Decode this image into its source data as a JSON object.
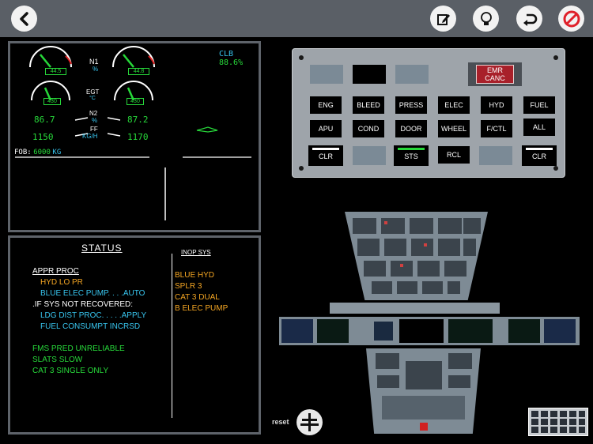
{
  "colors": {
    "topbar": "#5a5f66",
    "green": "#27d83a",
    "cyan": "#38c6f0",
    "amber": "#f5a623",
    "white": "#ffffff"
  },
  "toolbar": {
    "back_icon": "chevron-left-icon",
    "edit_icon": "edit-icon",
    "hint_icon": "lightbulb-icon",
    "undo_icon": "undo-icon",
    "cancel_icon": "no-entry-icon"
  },
  "ewd": {
    "n1_label": "N1",
    "n1_unit": "%",
    "n1_left": "44.5",
    "n1_right": "44.8",
    "mode": "CLB",
    "thrust_limit": "88.6%",
    "egt_label": "EGT",
    "egt_unit": "°C",
    "egt_left": "430",
    "egt_right": "430",
    "n2_label": "N2",
    "n2_unit": "%",
    "n2_left": "86.7",
    "n2_right": "87.2",
    "ff_label": "FF",
    "ff_unit": "KG/H",
    "ff_left": "1150",
    "ff_right": "1170",
    "fob_label": "FOB:",
    "fob_value": "6000",
    "fob_unit": "KG"
  },
  "status": {
    "title": "STATUS",
    "appr_proc": "APPR PROC",
    "lines": [
      {
        "text": "HYD LO PR"
      },
      {
        "text": "BLUE ELEC PUMP. . . .AUTO"
      },
      {
        "text": ".IF SYS NOT RECOVERED:"
      },
      {
        "text": "LDG DIST PROC. . . . .APPLY"
      },
      {
        "text": "FUEL CONSUMPT INCRSD"
      },
      {
        "text": "FMS PRED UNRELIABLE"
      },
      {
        "text": "SLATS SLOW"
      },
      {
        "text": "CAT 3 SINGLE ONLY"
      }
    ],
    "inop_title": "INOP SYS",
    "inop": [
      "BLUE HYD",
      "SPLR 3",
      "CAT 3 DUAL",
      "B ELEC PUMP"
    ]
  },
  "ecp": {
    "emr_canc": "EMR\nCANC",
    "emr_line1": "EMR",
    "emr_line2": "CANC",
    "row1": [
      "ENG",
      "BLEED",
      "PRESS",
      "ELEC",
      "HYD",
      "FUEL"
    ],
    "row2": [
      "APU",
      "COND",
      "DOOR",
      "WHEEL",
      "F/CTL",
      "ALL"
    ],
    "clr_left": "CLR",
    "sts": "STS",
    "rcl": "RCL",
    "clr_right": "CLR"
  },
  "footer": {
    "reset": "reset",
    "reset_icon": "reset-icon"
  }
}
